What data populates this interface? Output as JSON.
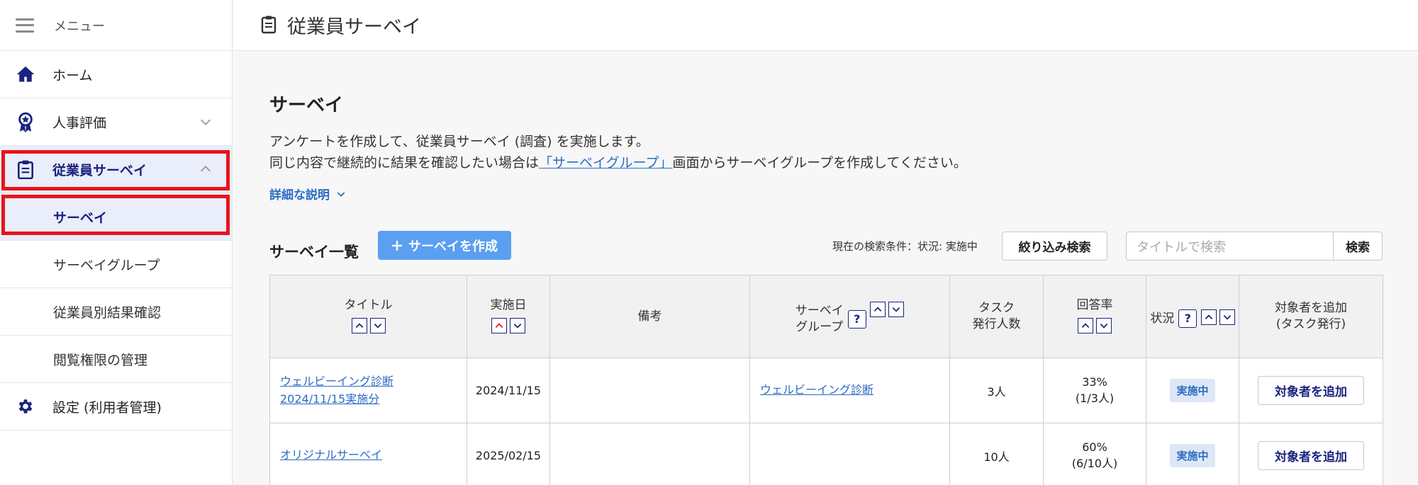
{
  "sidebar": {
    "menu_label": "メニュー",
    "items": [
      {
        "label": "ホーム"
      },
      {
        "label": "人事評価"
      },
      {
        "label": "従業員サーベイ"
      },
      {
        "label": "設定 (利用者管理)"
      }
    ],
    "sub_items": [
      {
        "label": "サーベイ"
      },
      {
        "label": "サーベイグループ"
      },
      {
        "label": "従業員別結果確認"
      },
      {
        "label": "閲覧権限の管理"
      }
    ]
  },
  "header": {
    "title": "従業員サーベイ"
  },
  "main": {
    "section_title": "サーベイ",
    "desc_line1": "アンケートを作成して、従業員サーベイ (調査) を実施します。",
    "desc_line2_pre": "同じ内容で継続的に結果を確認したい場合は",
    "desc_line2_link": "「サーベイグループ」",
    "desc_line2_post": "画面からサーベイグループを作成してください。",
    "detail_link": "詳細な説明",
    "list_title": "サーベイ一覧",
    "create_button": "サーベイを作成",
    "search_condition": "現在の検索条件：状況: 実施中",
    "filter_button": "絞り込み検索",
    "search_placeholder": "タイトルで検索",
    "search_button": "検索"
  },
  "table": {
    "headers": {
      "title": "タイトル",
      "date": "実施日",
      "note": "備考",
      "group_line1": "サーベイ",
      "group_line2": "グループ",
      "tasks_line1": "タスク",
      "tasks_line2": "発行人数",
      "rate": "回答率",
      "status": "状況",
      "add_line1": "対象者を追加",
      "add_line2": "(タスク発行)"
    },
    "help_glyph": "?",
    "rows": [
      {
        "title_line1": "ウェルビーイング診断",
        "title_line2": "2024/11/15実施分",
        "date": "2024/11/15",
        "note": "",
        "group": "ウェルビーイング診断",
        "tasks": "3人",
        "rate_pct": "33%",
        "rate_frac": "(1/3人)",
        "status": "実施中",
        "add_button": "対象者を追加"
      },
      {
        "title_line1": "オリジナルサーベイ",
        "title_line2": "",
        "date": "2025/02/15",
        "note": "",
        "group": "",
        "tasks": "10人",
        "rate_pct": "60%",
        "rate_frac": "(6/10人)",
        "status": "実施中",
        "add_button": "対象者を追加"
      }
    ]
  },
  "colors": {
    "accent": "#1a237e",
    "link": "#2b6cc4",
    "primary_button": "#5b9ff0",
    "highlight_red": "#e8141b",
    "active_bg": "#e9eefa"
  }
}
